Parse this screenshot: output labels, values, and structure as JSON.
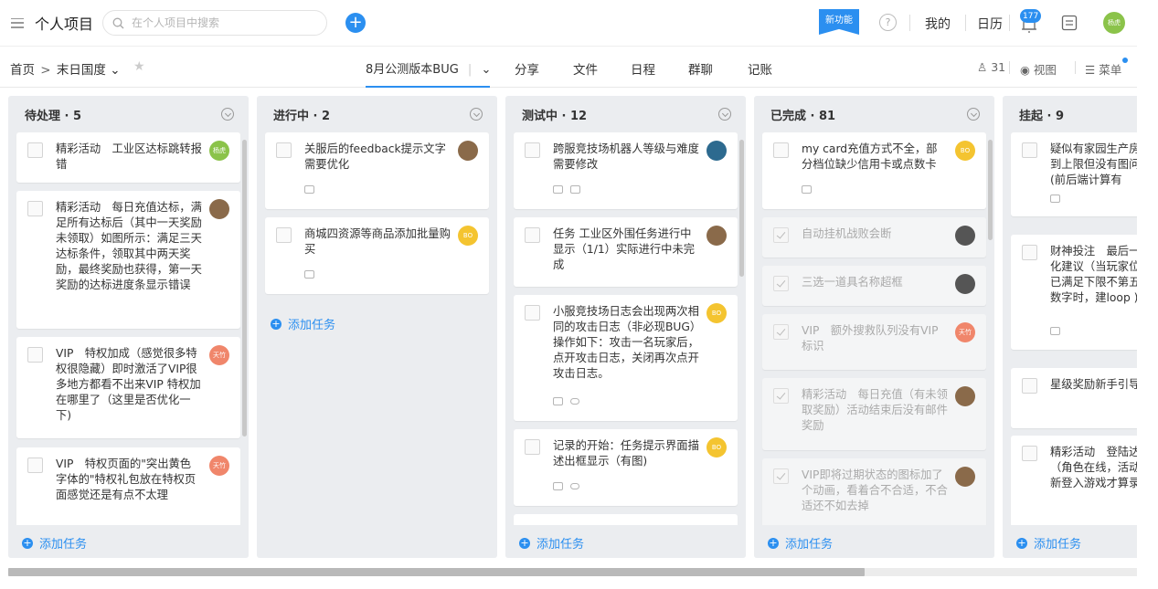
{
  "topbar": {
    "project_title": "个人项目",
    "search_placeholder": "在个人项目中搜索",
    "new_feature_label": "新功能",
    "help_label": "?",
    "mine_label": "我的",
    "calendar_label": "日历",
    "notification_count": "177",
    "avatar_text": "杨虎"
  },
  "subbar": {
    "breadcrumb_home": "首页",
    "breadcrumb_sep": ">",
    "breadcrumb_project": "末日国度",
    "view_tab_label": "8月公测版本BUG",
    "nav": [
      "分享",
      "文件",
      "日程",
      "群聊",
      "记账"
    ],
    "member_count": "31",
    "view_label": "视图",
    "menu_label": "菜单"
  },
  "columns": [
    {
      "title": "待处理 · 5",
      "add_label": "添加任务",
      "cards": [
        {
          "title": "精彩活动　工业区达标跳转报错",
          "avatar": "杨虎",
          "avatar_color": "#8bc34a",
          "meta": []
        },
        {
          "title": "精彩活动　每日充值达标，满足所有达标后（其中一天奖励未领取）如图所示：满足三天达标条件，领取其中两天奖励，最终奖励也获得，第一天奖励的达标进度条显示错误",
          "avatar": "",
          "avatar_color": "#8a6a4a",
          "meta": []
        },
        {
          "title": "VIP　特权加成（感觉很多特权很隐藏）即时激活了VIP很多地方都看不出来VIP 特权加在哪里了（这里是否优化一下)",
          "avatar": "天竹",
          "avatar_color": "#f0866b",
          "meta": []
        },
        {
          "title": "VIP　特权页面的\"突出黄色字体的\"特权礼包放在特权页面感觉还是有点不太理",
          "avatar": "天竹",
          "avatar_color": "#f0866b",
          "meta": []
        }
      ]
    },
    {
      "title": "进行中 · 2",
      "add_label": "添加任务",
      "cards": [
        {
          "title": "关服后的feedback提示文字需要优化",
          "avatar": "",
          "avatar_color": "#8a6a4a",
          "meta": [
            "comment"
          ]
        },
        {
          "title": "商城四资源等商品添加批量购买",
          "avatar": "BO",
          "avatar_color": "#f4c430",
          "meta": [
            "comment"
          ]
        }
      ]
    },
    {
      "title": "测试中 · 12",
      "add_label": "添加任务",
      "cards": [
        {
          "title": "跨服竞技场机器人等级与难度需要修改",
          "avatar": "",
          "avatar_color": "#2d6a8f",
          "meta": [
            "desc",
            "comment"
          ]
        },
        {
          "title": "任务 工业区外围任务进行中显示（1/1）实际进行中未完成",
          "avatar": "",
          "avatar_color": "#8a6a4a",
          "meta": []
        },
        {
          "title": "小服竞技场日志会出现两次相同的攻击日志（非必现BUG）操作如下：攻击一名玩家后，点开攻击日志，关闭再次点开攻击日志。",
          "avatar": "BO",
          "avatar_color": "#f4c430",
          "meta": [
            "comment",
            "attach"
          ]
        },
        {
          "title": "记录的开始：任务提示界面描述出框显示（有图)",
          "avatar": "BO",
          "avatar_color": "#f4c430",
          "meta": [
            "comment",
            "attach"
          ]
        }
      ]
    },
    {
      "title": "已完成 · 81",
      "add_label": "添加任务",
      "cards": [
        {
          "title": "my card充值方式不全，部分档位缺少信用卡或点数卡",
          "avatar": "BO",
          "avatar_color": "#f4c430",
          "meta": [
            "comment"
          ],
          "done": false
        },
        {
          "title": "自动挂机战败会断",
          "avatar": "",
          "avatar_color": "#555555",
          "meta": [],
          "done": true
        },
        {
          "title": "三选一道具名称超框",
          "avatar": "",
          "avatar_color": "#555555",
          "meta": [],
          "done": true
        },
        {
          "title": "VIP　额外搜救队列没有VIP标识",
          "avatar": "天竹",
          "avatar_color": "#f0866b",
          "meta": [],
          "done": true
        },
        {
          "title": "精彩活动　每日充值（有未领取奖励）活动结束后没有邮件奖励",
          "avatar": "",
          "avatar_color": "#8a6a4a",
          "meta": [],
          "done": true
        },
        {
          "title": "VIP即将过期状态的图标加了个动画，看着合不合适，不合适还不如去掉",
          "avatar": "",
          "avatar_color": "#8a6a4a",
          "meta": [],
          "done": true
        }
      ]
    },
    {
      "title": "挂起 · 9",
      "add_label": "添加任务",
      "cards": [
        {
          "title": "疑似有家园生产房达到上限但没有图问题(前后端计算有",
          "avatar": "",
          "avatar_color": "",
          "meta": [
            "comment"
          ]
        },
        {
          "title": "财神投注　最后一优化建议（当玩家位数已满足下限不第五位数字时，建loop )",
          "avatar": "",
          "avatar_color": "",
          "meta": [
            "comment"
          ]
        },
        {
          "title": "星级奖励新手引导加",
          "avatar": "",
          "avatar_color": "",
          "meta": []
        },
        {
          "title": "精彩活动　登陆达（角色在线，活动重新登入游戏才算录)",
          "avatar": "",
          "avatar_color": "",
          "meta": []
        }
      ]
    }
  ]
}
